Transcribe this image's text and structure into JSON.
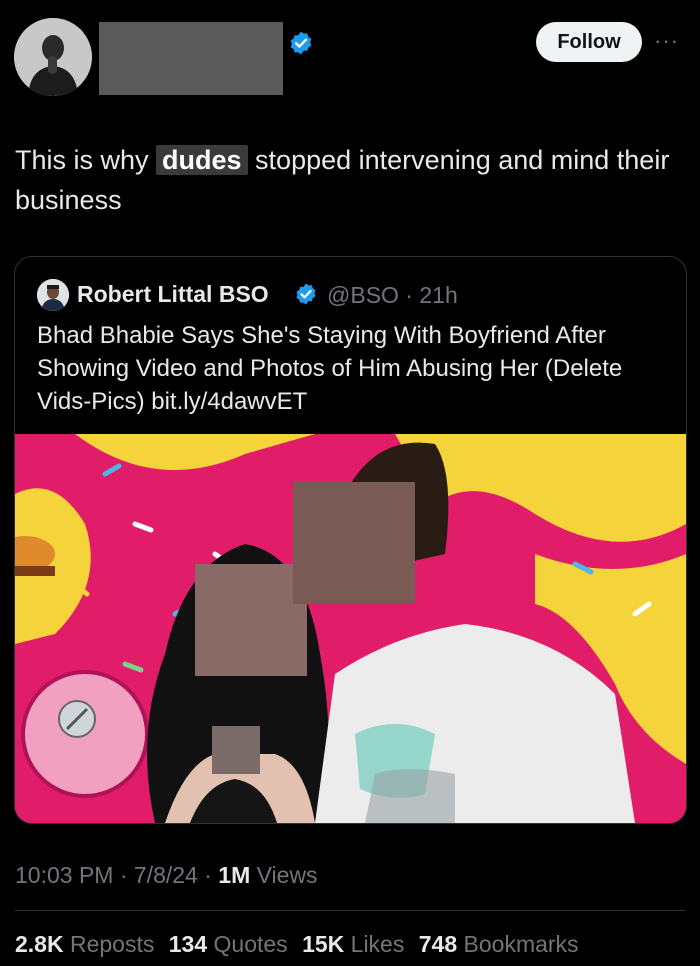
{
  "header": {
    "follow_label": "Follow",
    "more_label": "···"
  },
  "tweet": {
    "text_before": "This is why ",
    "text_highlight": "dudes",
    "text_after": " stopped intervening and mind their business"
  },
  "quote": {
    "author_name": "Robert Littal BSO",
    "handle_time": "@BSO · 21h",
    "text": "Bhad Bhabie Says She's Staying With Boyfriend After Showing Video and Photos of Him Abusing Her (Delete Vids-Pics) bit.ly/4dawvET"
  },
  "meta": {
    "timestamp": "10:03 PM · 7/8/24 · ",
    "views_count": "1M",
    "views_label": " Views"
  },
  "stats": {
    "reposts_count": "2.8K",
    "reposts_label": "Reposts",
    "quotes_count": "134",
    "quotes_label": "Quotes",
    "likes_count": "15K",
    "likes_label": "Likes",
    "bookmarks_count": "748",
    "bookmarks_label": "Bookmarks"
  },
  "colors": {
    "background": "#000000",
    "verified": "#1d9bf0",
    "secondary_text": "#71767b",
    "primary_text": "#e7e9ea"
  }
}
